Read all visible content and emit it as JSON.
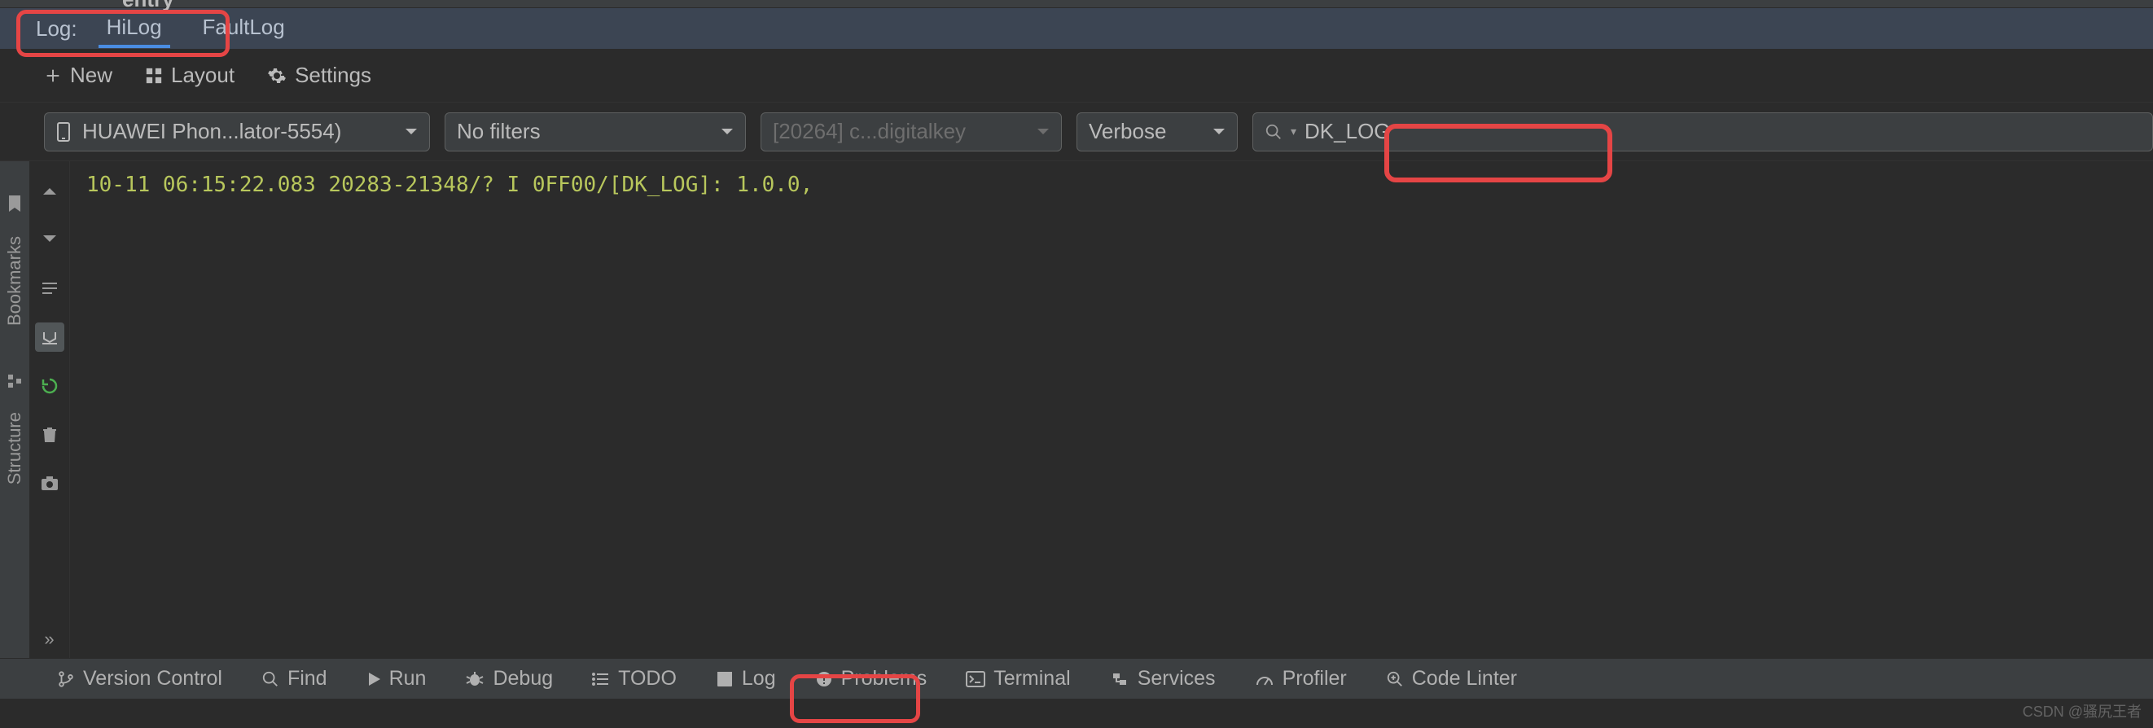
{
  "topFragment": {
    "entry": "entry"
  },
  "logHeader": {
    "label": "Log:",
    "tabs": {
      "hilog": "HiLog",
      "faultlog": "FaultLog"
    }
  },
  "toolbar": {
    "new": "New",
    "layout": "Layout",
    "settings": "Settings"
  },
  "filters": {
    "device": "HUAWEI Phon...lator-5554)",
    "filterMode": "No filters",
    "process": "[20264] c...digitalkey",
    "level": "Verbose",
    "search": "DK_LOG"
  },
  "logLine": "10-11 06:15:22.083 20283-21348/? I 0FF00/[DK_LOG]: 1.0.0,",
  "sidebar": {
    "bookmarks": "Bookmarks",
    "structure": "Structure"
  },
  "bottom": {
    "vcs": "Version Control",
    "find": "Find",
    "run": "Run",
    "debug": "Debug",
    "todo": "TODO",
    "log": "Log",
    "problems": "Problems",
    "terminal": "Terminal",
    "services": "Services",
    "profiler": "Profiler",
    "lint": "Code Linter"
  },
  "watermark": "CSDN @骚尻王者"
}
